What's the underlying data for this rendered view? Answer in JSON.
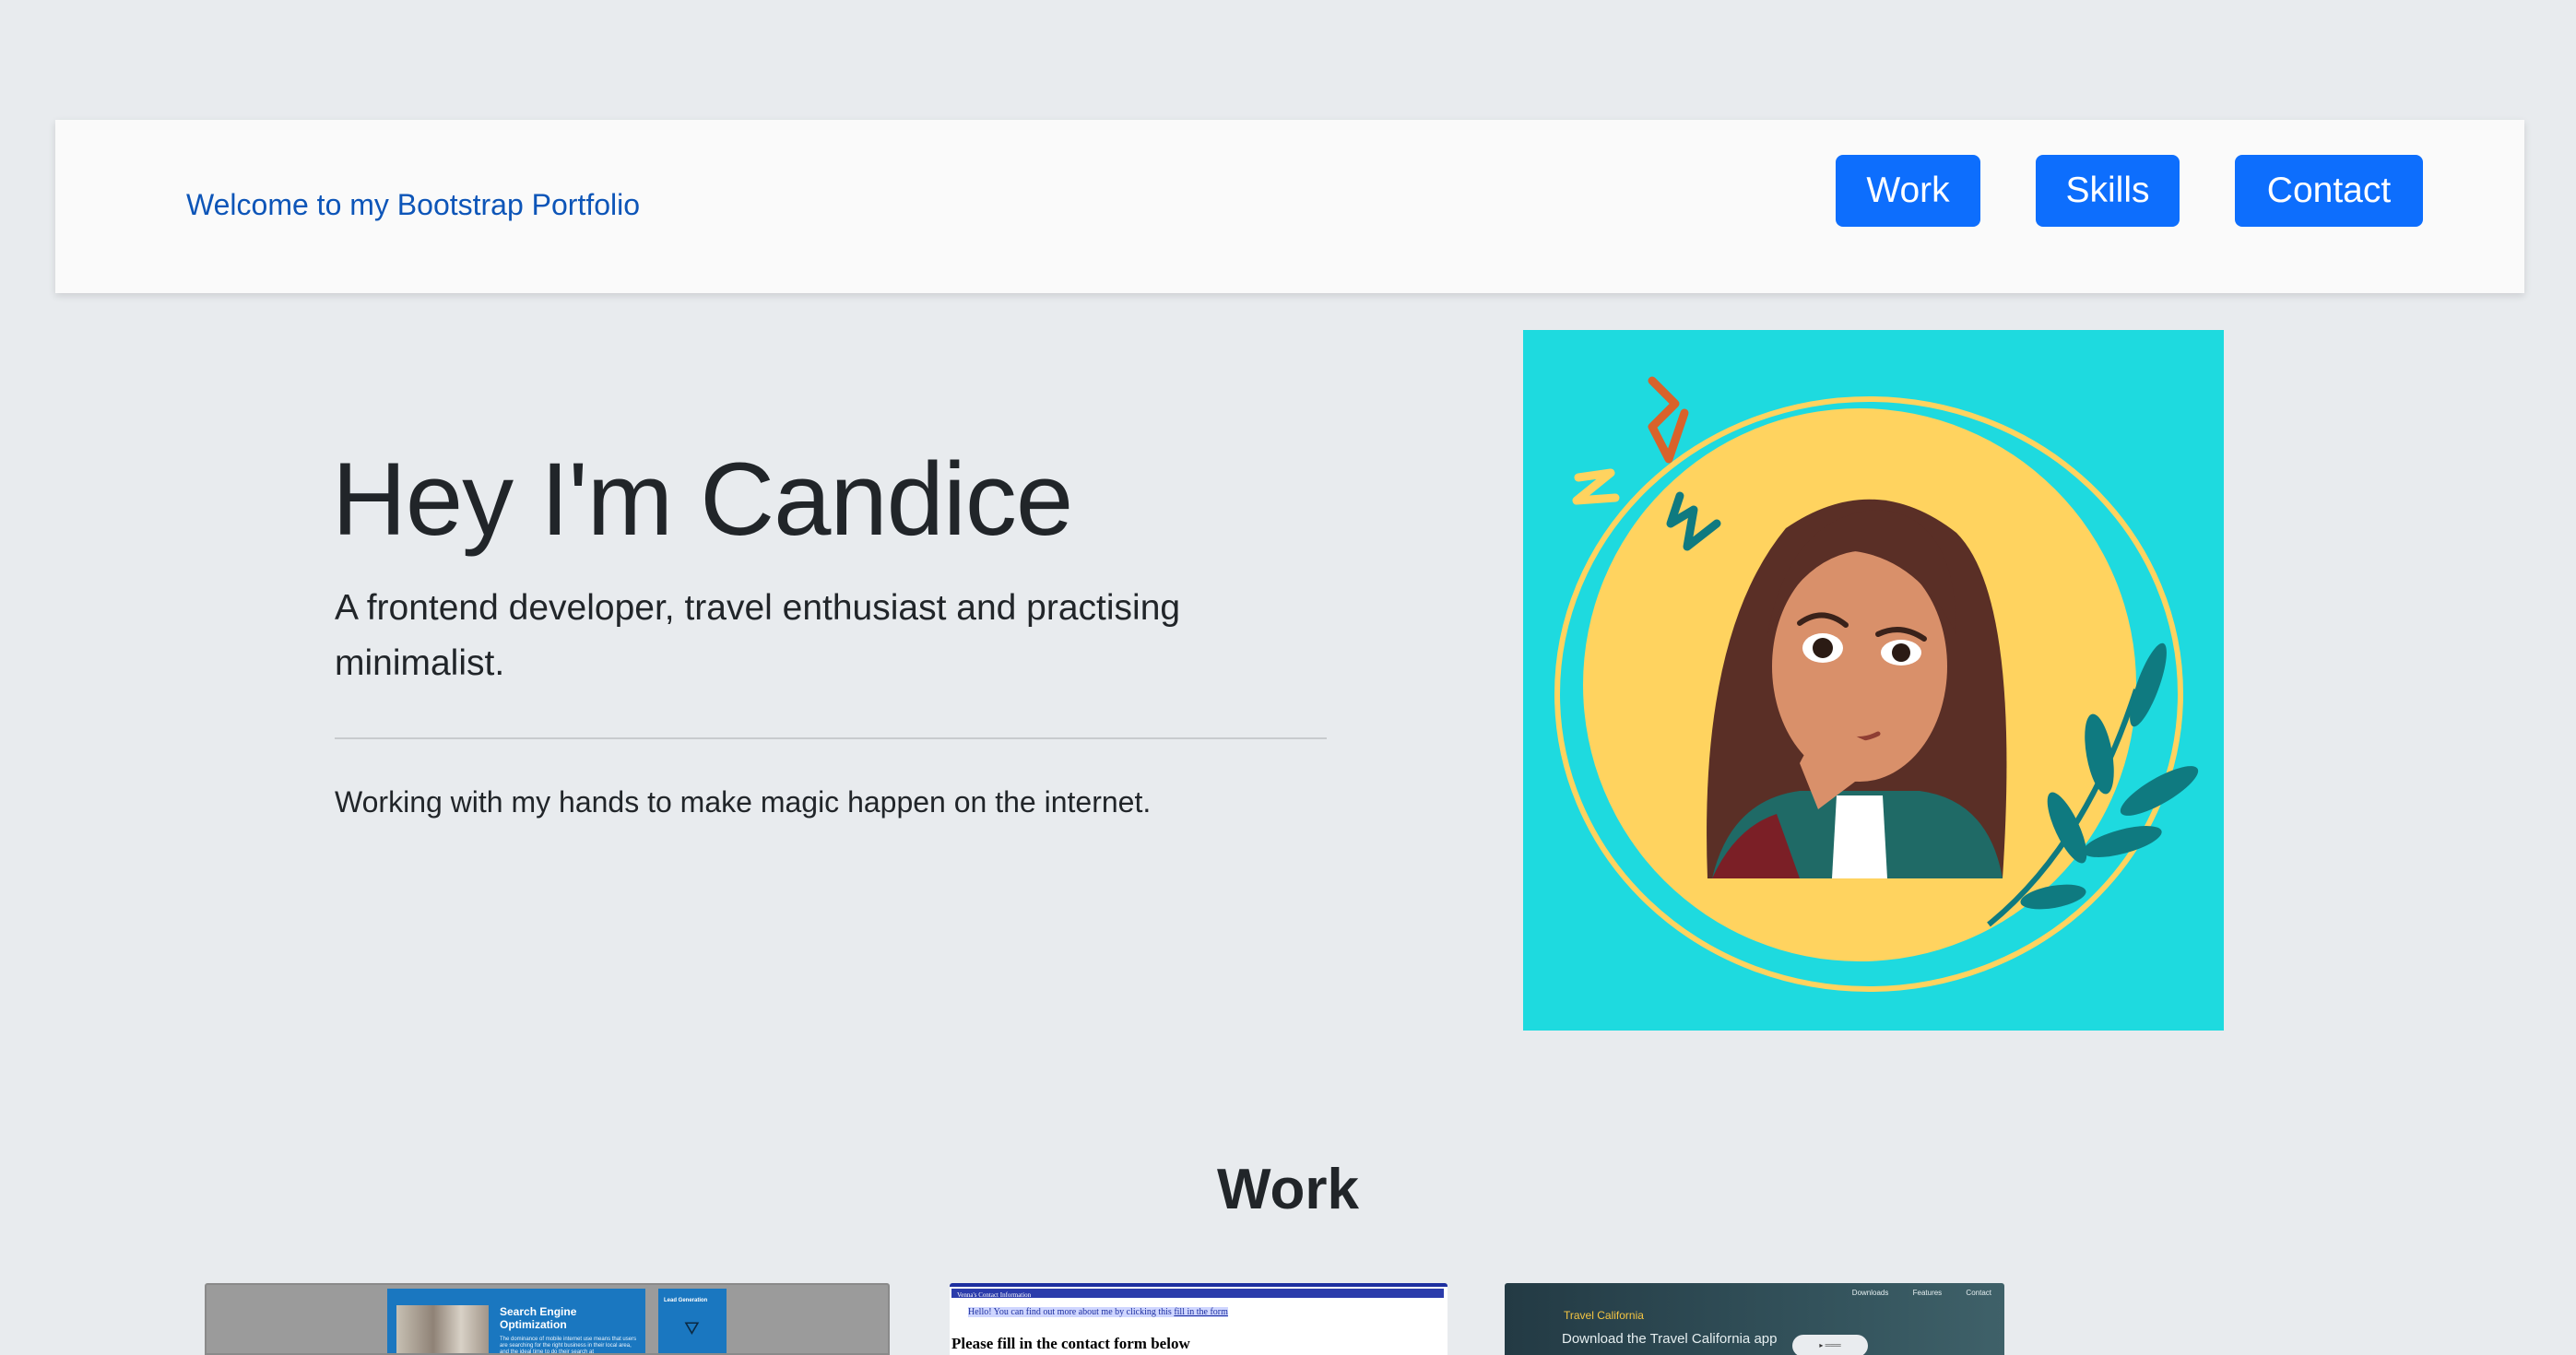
{
  "navbar": {
    "brand": "Welcome to my Bootstrap Portfolio",
    "buttons": {
      "work": "Work",
      "skills": "Skills",
      "contact": "Contact"
    },
    "button_color": "#0d6efd",
    "brand_color": "#0d55b8"
  },
  "hero": {
    "title": "Hey I'm Candice",
    "lead": "A frontend developer, travel enthusiast and practising minimalist.",
    "text": "Working with my hands to make magic happen on the internet.",
    "avatar_background": "#1edadf",
    "avatar_circle": "#ffd35f"
  },
  "work": {
    "title": "Work",
    "projects": [
      {
        "seo_title": "Search Engine Optimization",
        "seo_body": "The dominance of mobile internet use means that users are searching for the right business in their local area, and the ideal time to do their search at",
        "lead_title": "Lead Generation",
        "icon": "mouse-pointer-icon"
      },
      {
        "bar_text": "Venna's Contact Information",
        "hello_prefix": "Hello! You can find out more about me by clicking this",
        "hello_link": "fill in the form",
        "heading": "Please fill in the contact form below"
      },
      {
        "nav": [
          "Downloads",
          "Features",
          "Contact"
        ],
        "brand": "Travel California",
        "headline": "Download the Travel California app",
        "pill": "▸ ═══"
      }
    ]
  }
}
